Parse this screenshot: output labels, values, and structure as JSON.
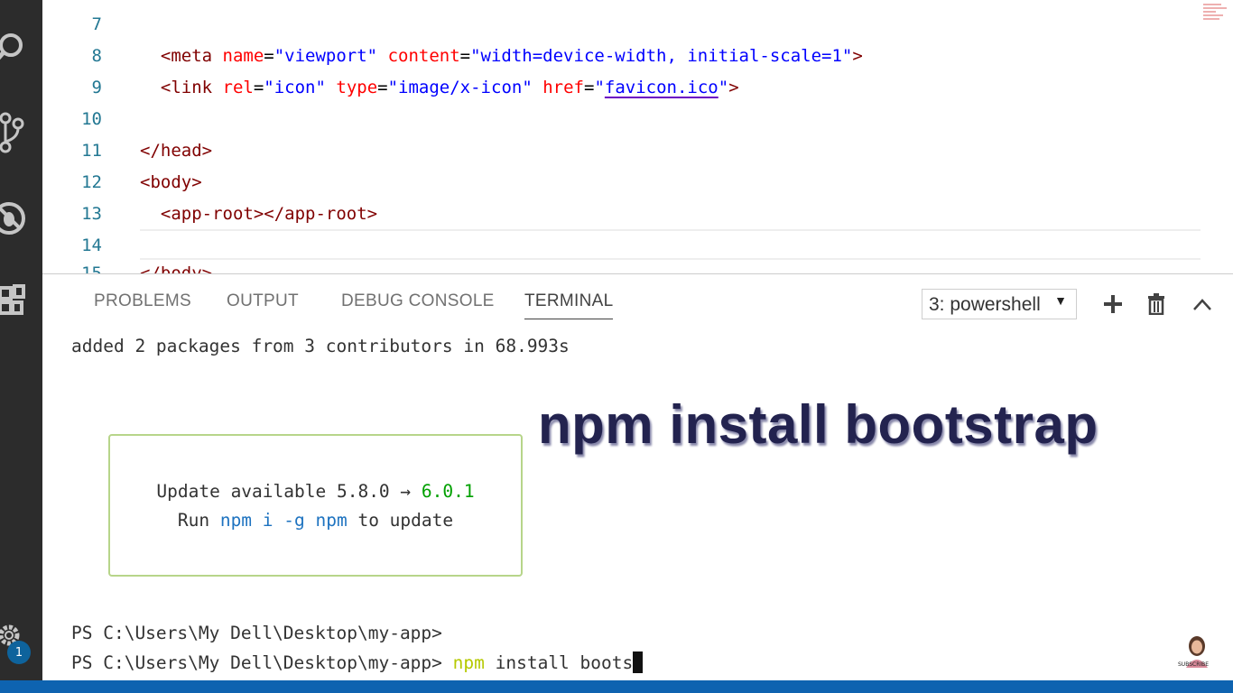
{
  "editor": {
    "lines": [
      {
        "num": "7",
        "parts": []
      },
      {
        "num": "8",
        "parts": [
          {
            "c": "t-tag",
            "t": "  <meta "
          },
          {
            "c": "t-attr",
            "t": "name"
          },
          {
            "c": "",
            "t": "="
          },
          {
            "c": "t-str",
            "t": "\"viewport\""
          },
          {
            "c": "",
            "t": " "
          },
          {
            "c": "t-attr",
            "t": "content"
          },
          {
            "c": "",
            "t": "="
          },
          {
            "c": "t-str",
            "t": "\"width=device-width, initial-scale=1\""
          },
          {
            "c": "t-tag",
            "t": ">"
          }
        ]
      },
      {
        "num": "9",
        "parts": [
          {
            "c": "t-tag",
            "t": "  <link "
          },
          {
            "c": "t-attr",
            "t": "rel"
          },
          {
            "c": "",
            "t": "="
          },
          {
            "c": "t-str",
            "t": "\"icon\""
          },
          {
            "c": "",
            "t": " "
          },
          {
            "c": "t-attr",
            "t": "type"
          },
          {
            "c": "",
            "t": "="
          },
          {
            "c": "t-str",
            "t": "\"image/x-icon\""
          },
          {
            "c": "",
            "t": " "
          },
          {
            "c": "t-attr",
            "t": "href"
          },
          {
            "c": "",
            "t": "="
          },
          {
            "c": "t-str",
            "t": "\""
          },
          {
            "c": "t-link",
            "t": "favicon.ico"
          },
          {
            "c": "t-str",
            "t": "\""
          },
          {
            "c": "t-tag",
            "t": ">"
          }
        ]
      },
      {
        "num": "10",
        "parts": []
      },
      {
        "num": "11",
        "parts": [
          {
            "c": "t-tag",
            "t": "</head>"
          }
        ]
      },
      {
        "num": "12",
        "parts": [
          {
            "c": "t-tag",
            "t": "<body>"
          }
        ]
      },
      {
        "num": "13",
        "parts": [
          {
            "c": "t-tag",
            "t": "  <app-root></app-root>"
          }
        ]
      },
      {
        "num": "14",
        "parts": []
      }
    ]
  },
  "panel": {
    "tabs": [
      {
        "label": "PROBLEMS"
      },
      {
        "label": "OUTPUT"
      },
      {
        "label": "DEBUG CONSOLE"
      },
      {
        "label": "TERMINAL"
      }
    ],
    "terminal_select": "3: powershell"
  },
  "terminal": {
    "added_line": "added 2 packages from 3 contributors in 68.993s",
    "update": {
      "prefix": "Update available 5.8.0 → ",
      "new_version": "6.0.1",
      "run": "Run ",
      "cmd": "npm i -g npm",
      "suffix": " to update"
    },
    "prompt1": "PS C:\\Users\\My Dell\\Desktop\\my-app>",
    "prompt2": "PS C:\\Users\\My Dell\\Desktop\\my-app> ",
    "typed_cmd": "npm",
    "typed_rest": " install boots"
  },
  "overlay_title": "npm install bootstrap",
  "activity": {
    "badge_count": "1",
    "icons": [
      "search-icon",
      "source-control-icon",
      "debug-icon",
      "extensions-icon",
      "gear-icon"
    ]
  },
  "avatar_label": "SUBSCRIBE",
  "colors": {
    "activity_bar": "#2c2c2c",
    "status_bar": "#0e63b0",
    "tag": "#800000",
    "attr": "#ff0000",
    "string": "#0000ff",
    "update_green": "#00a000",
    "npm_blue": "#1e73c0"
  }
}
